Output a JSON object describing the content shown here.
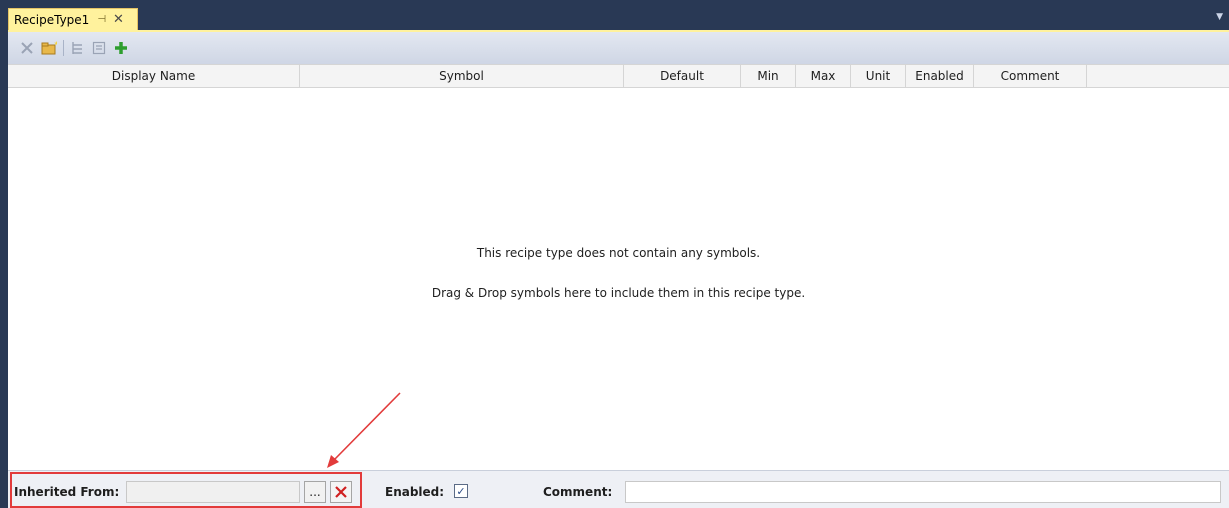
{
  "tab": {
    "title": "RecipeType1",
    "pin_glyph": "⊣",
    "close_glyph": "✕"
  },
  "toolbar": {
    "icons": [
      "delete-icon",
      "new-folder-icon",
      "indent-icon",
      "outdent-icon",
      "add-icon"
    ]
  },
  "columns": [
    "Display Name",
    "Symbol",
    "Default",
    "Min",
    "Max",
    "Unit",
    "Enabled",
    "Comment"
  ],
  "empty_state": {
    "line1": "This recipe type does not contain any symbols.",
    "line2": "Drag & Drop symbols here to include them in this recipe type."
  },
  "footer": {
    "inherited_label": "Inherited From:",
    "inherited_value": "",
    "browse_label": "...",
    "enabled_label": "Enabled:",
    "enabled_checked": true,
    "comment_label": "Comment:",
    "comment_value": ""
  },
  "colors": {
    "frame": "#293955",
    "tab_active": "#fff29d",
    "add_green": "#2e9e2e",
    "delete_red": "#d02020",
    "annotation_red": "#e23b3b"
  }
}
